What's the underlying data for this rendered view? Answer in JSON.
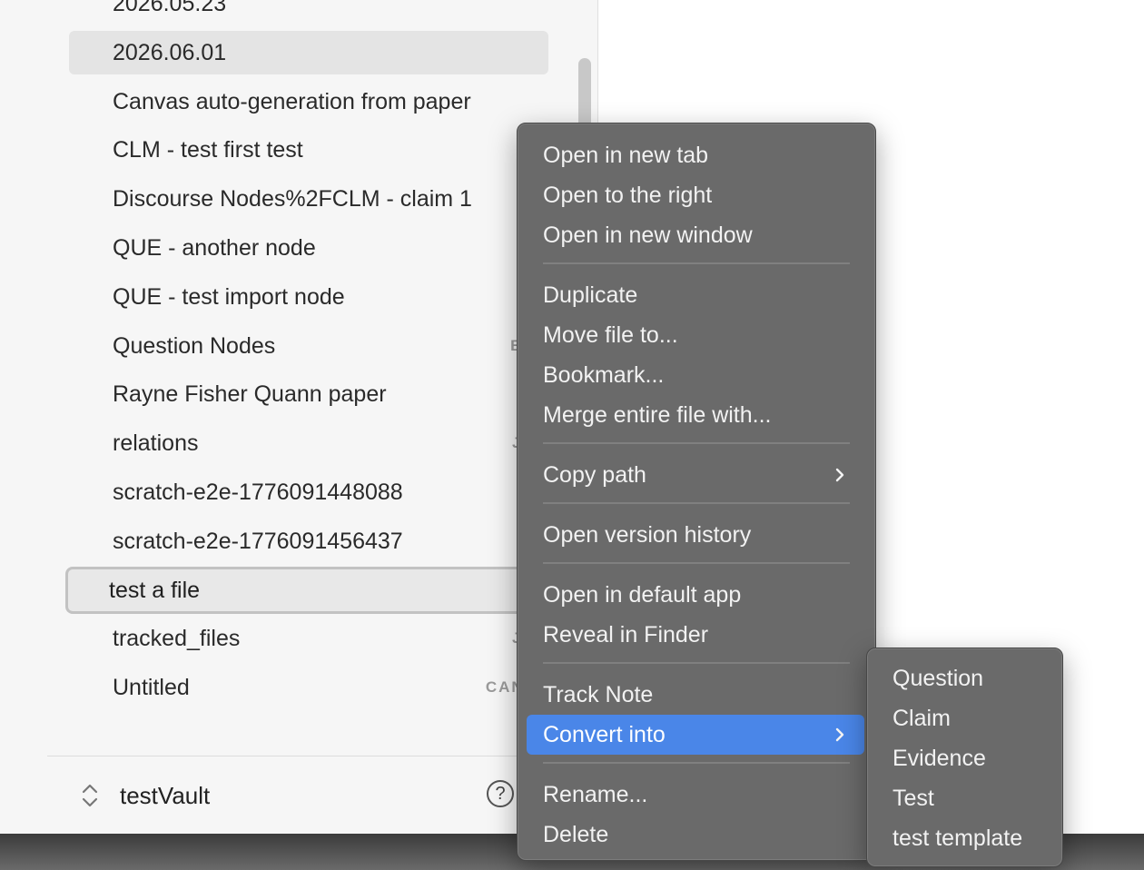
{
  "sidebar": {
    "files": [
      {
        "label": "2026.05.23",
        "badge": "",
        "state": "normal"
      },
      {
        "label": "2026.06.01",
        "badge": "",
        "state": "hover"
      },
      {
        "label": "Canvas auto-generation from paper",
        "badge": "",
        "state": "normal"
      },
      {
        "label": "CLM - test first test",
        "badge": "",
        "state": "normal"
      },
      {
        "label": "Discourse Nodes%2FCLM - claim 1",
        "badge": "",
        "state": "normal"
      },
      {
        "label": "QUE - another node",
        "badge": "",
        "state": "normal"
      },
      {
        "label": "QUE - test import node",
        "badge": "",
        "state": "normal"
      },
      {
        "label": "Question Nodes",
        "badge": "BAS",
        "state": "normal"
      },
      {
        "label": "Rayne Fisher Quann paper",
        "badge": "",
        "state": "normal"
      },
      {
        "label": "relations",
        "badge": "JSO",
        "state": "normal"
      },
      {
        "label": "scratch-e2e-1776091448088",
        "badge": "",
        "state": "normal"
      },
      {
        "label": "scratch-e2e-1776091456437",
        "badge": "",
        "state": "normal"
      },
      {
        "label": "test a file",
        "badge": "",
        "state": "focused"
      },
      {
        "label": "tracked_files",
        "badge": "JSO",
        "state": "normal"
      },
      {
        "label": "Untitled",
        "badge": "CANVA",
        "state": "normal"
      }
    ],
    "vault_name": "testVault",
    "help_label": "?"
  },
  "context_menu": {
    "items": [
      {
        "label": "Open in new tab"
      },
      {
        "label": "Open to the right"
      },
      {
        "label": "Open in new window"
      },
      {
        "label": "Duplicate"
      },
      {
        "label": "Move file to..."
      },
      {
        "label": "Bookmark..."
      },
      {
        "label": "Merge entire file with..."
      },
      {
        "label": "Copy path",
        "submenu": true
      },
      {
        "label": "Open version history"
      },
      {
        "label": "Open in default app"
      },
      {
        "label": "Reveal in Finder"
      },
      {
        "label": "Track Note"
      },
      {
        "label": "Convert into",
        "submenu": true,
        "active": true
      },
      {
        "label": "Rename..."
      },
      {
        "label": "Delete"
      }
    ]
  },
  "submenu": {
    "items": [
      {
        "label": "Question"
      },
      {
        "label": "Claim"
      },
      {
        "label": "Evidence"
      },
      {
        "label": "Test"
      },
      {
        "label": "test template"
      }
    ]
  },
  "colors": {
    "menu_bg": "#6a6a6a",
    "menu_active": "#4a86e8",
    "sidebar_bg": "#f6f6f6"
  }
}
